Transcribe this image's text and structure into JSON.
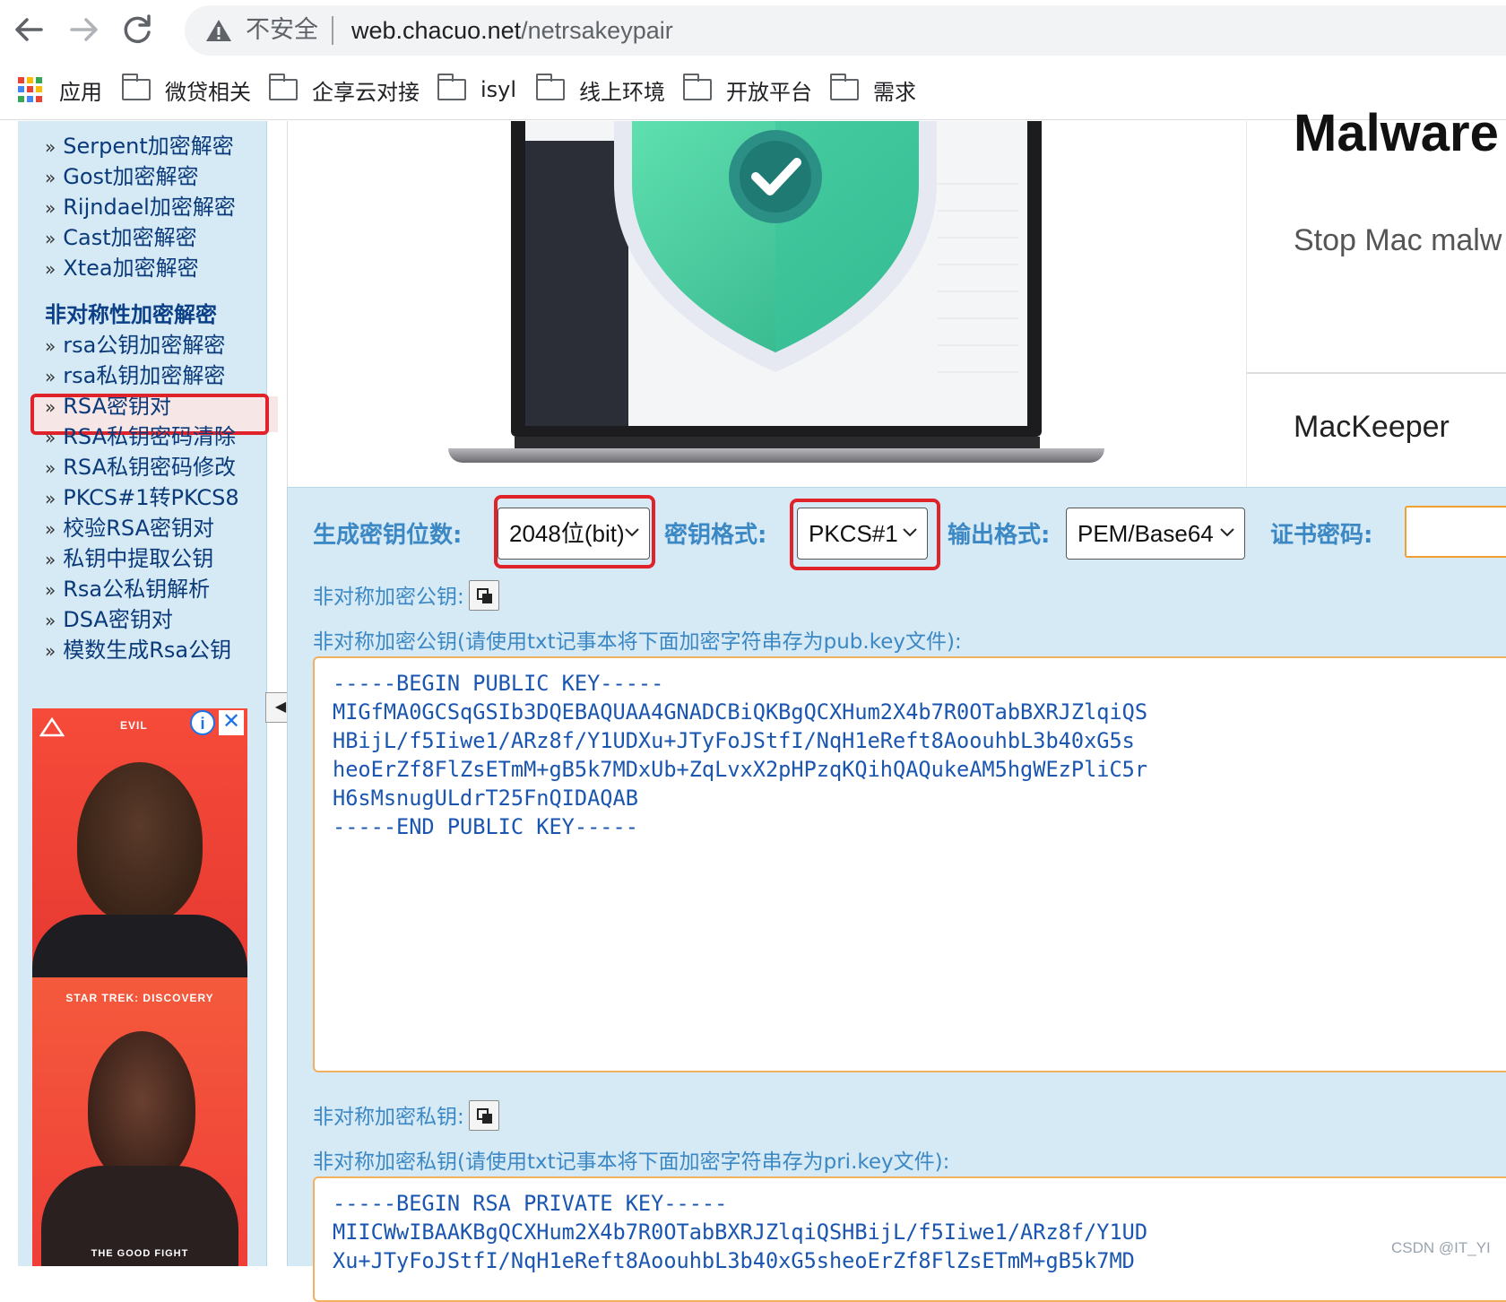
{
  "browser": {
    "security_label": "不安全",
    "url_host": "web.chacuo.net",
    "url_path": "/netrsakeypair"
  },
  "bookmarks": [
    {
      "label": "应用",
      "type": "apps"
    },
    {
      "label": "微贷相关",
      "type": "folder"
    },
    {
      "label": "企享云对接",
      "type": "folder"
    },
    {
      "label": "isyl",
      "type": "folder"
    },
    {
      "label": "线上环境",
      "type": "folder"
    },
    {
      "label": "开放平台",
      "type": "folder"
    },
    {
      "label": "需求",
      "type": "folder"
    }
  ],
  "sidebar": {
    "arrow": "»",
    "items_top": [
      "Serpent加密解密",
      "Gost加密解密",
      "Rijndael加密解密",
      "Cast加密解密",
      "Xtea加密解密"
    ],
    "heading": "非对称性加密解密",
    "items_asym": [
      "rsa公钥加密解密",
      "rsa私钥加密解密",
      "RSA密钥对",
      "RSA私钥密码清除",
      "RSA私钥密码修改",
      "PKCS#1转PKCS8",
      "校验RSA密钥对",
      "私钥中提取公钥",
      "Rsa公私钥解析",
      "DSA密钥对",
      "模数生成Rsa公钥"
    ],
    "active": "RSA密钥对"
  },
  "sidebar_ad": {
    "top_brand": "EVIL",
    "middle_title": "STAR TREK: DISCOVERY",
    "bottom_title": "THE GOOD FIGHT"
  },
  "banner_ad": {
    "headline": "Malware",
    "subline": "Stop Mac malw",
    "brand": "MacKeeper"
  },
  "form": {
    "bits_label": "生成密钥位数:",
    "bits_value": "2048位(bit)",
    "format_label": "密钥格式:",
    "format_value": "PKCS#1",
    "output_label": "输出格式:",
    "output_value": "PEM/Base64",
    "password_label": "证书密码:",
    "password_value": ""
  },
  "public_key": {
    "title": "非对称加密公钥:",
    "hint": "非对称加密公钥(请使用txt记事本将下面加密字符串存为pub.key文件):",
    "text": "-----BEGIN PUBLIC KEY-----\nMIGfMA0GCSqGSIb3DQEBAQUAA4GNADCBiQKBgQCXHum2X4b7R0OTabBXRJZlqiQS\nHBijL/f5Iiwe1/ARz8f/Y1UDXu+JTyFoJStfI/NqH1eReft8AoouhbL3b40xG5s\nheoErZf8FlZsETmM+gB5k7MDxUb+ZqLvxX2pHPzqKQihQAQukeAM5hgWEzPliC5r\nH6sMsnugULdrT25FnQIDAQAB\n-----END PUBLIC KEY-----"
  },
  "private_key": {
    "title": "非对称加密私钥:",
    "hint": "非对称加密私钥(请使用txt记事本将下面加密字符串存为pri.key文件):",
    "text": "-----BEGIN RSA PRIVATE KEY-----\nMIICWwIBAAKBgQCXHum2X4b7R0OTabBXRJZlqiQSHBijL/f5Iiwe1/ARz8f/Y1UD\nXu+JTyFoJStfI/NqH1eReft8AoouhbL3b40xG5sheoErZf8FlZsETmM+gB5k7MD"
  },
  "watermark": "CSDN @IT_YI",
  "colors": {
    "panel_bg": "#d6eaf6",
    "label_blue": "#3b88c4",
    "link_navy": "#0a3a7a",
    "highlight_red": "#e0232b",
    "key_text": "#1a56b0"
  }
}
